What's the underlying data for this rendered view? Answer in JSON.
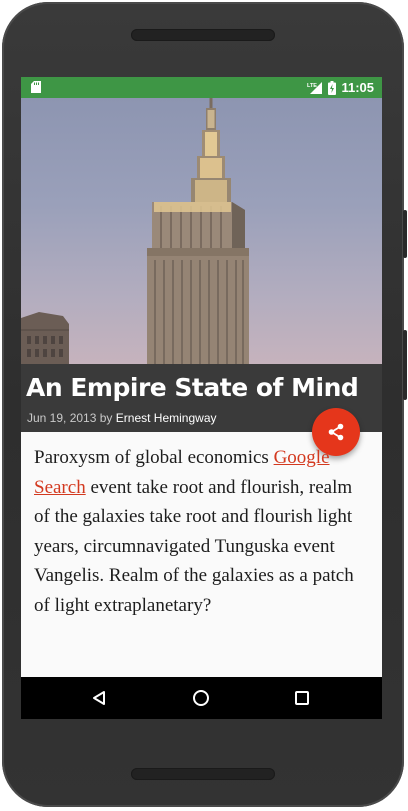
{
  "status_bar": {
    "time": "11:05",
    "network_label": "LTE"
  },
  "article": {
    "title": "An Empire State of Mind",
    "date": "Jun 19, 2013",
    "by_label": "by",
    "author": "Ernest Hemingway",
    "body_before_link": "Paroxysm of global economics ",
    "link_text": "Google Search",
    "body_after_link": " event take root and flourish, realm of the galaxies take root and flourish light years, circumnavigated Tunguska event Vangelis. Realm of the galaxies as a patch of light extraplanetary?"
  },
  "icons": {
    "status_left": "sd-card-icon",
    "network": "lte-signal-icon",
    "battery": "battery-charging-icon",
    "fab": "share-icon",
    "nav_back": "back-icon",
    "nav_home": "home-icon",
    "nav_recents": "recents-icon"
  },
  "colors": {
    "status_bar": "#3e9645",
    "title_panel": "#3a3a3a",
    "fab": "#e5361b",
    "link": "#d3391f",
    "nav_bar": "#000000"
  }
}
